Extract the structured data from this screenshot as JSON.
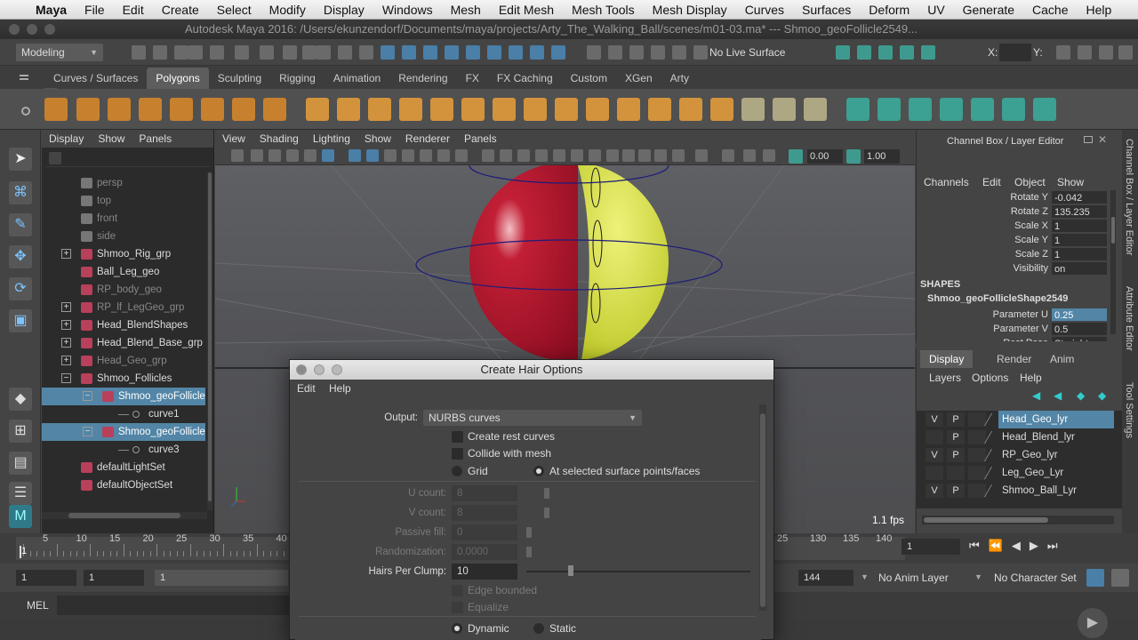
{
  "macmenu": {
    "apple": "",
    "items": [
      "Maya",
      "File",
      "Edit",
      "Create",
      "Select",
      "Modify",
      "Display",
      "Windows",
      "Mesh",
      "Edit Mesh",
      "Mesh Tools",
      "Mesh Display",
      "Curves",
      "Surfaces",
      "Deform",
      "UV",
      "Generate",
      "Cache",
      "Help"
    ]
  },
  "window": {
    "title": "Autodesk Maya 2016: /Users/ekunzendorf/Documents/maya/projects/Arty_The_Walking_Ball/scenes/m01-03.ma*   ---   Shmoo_geoFollicle2549..."
  },
  "statusline": {
    "menuset": "Modeling",
    "live_surface": "No Live Surface",
    "x_label": "X:",
    "y_label": "Y:"
  },
  "shelf_tabs": [
    "Curves / Surfaces",
    "Polygons",
    "Sculpting",
    "Rigging",
    "Animation",
    "Rendering",
    "FX",
    "FX Caching",
    "Custom",
    "XGen",
    "Arty"
  ],
  "outliner": {
    "menu": [
      "Display",
      "Show",
      "Panels"
    ],
    "rows": [
      {
        "label": "persp",
        "style": "dim",
        "indent": 0,
        "exp": ""
      },
      {
        "label": "top",
        "style": "dim",
        "indent": 0,
        "exp": ""
      },
      {
        "label": "front",
        "style": "dim",
        "indent": 0,
        "exp": ""
      },
      {
        "label": "side",
        "style": "dim",
        "indent": 0,
        "exp": ""
      },
      {
        "label": "Shmoo_Rig_grp",
        "style": "",
        "indent": 0,
        "exp": "+"
      },
      {
        "label": "Ball_Leg_geo",
        "style": "",
        "indent": 0,
        "exp": ""
      },
      {
        "label": "RP_body_geo",
        "style": "dim",
        "indent": 0,
        "exp": ""
      },
      {
        "label": "RP_lf_LegGeo_grp",
        "style": "dim",
        "indent": 0,
        "exp": "+"
      },
      {
        "label": "Head_BlendShapes",
        "style": "",
        "indent": 0,
        "exp": "+"
      },
      {
        "label": "Head_Blend_Base_grp",
        "style": "",
        "indent": 0,
        "exp": "+"
      },
      {
        "label": "Head_Geo_grp",
        "style": "dim",
        "indent": 0,
        "exp": "+"
      },
      {
        "label": "Shmoo_Follicles",
        "style": "",
        "indent": 0,
        "exp": "−"
      },
      {
        "label": "Shmoo_geoFollicle",
        "style": "sel",
        "indent": 1,
        "exp": "−"
      },
      {
        "label": "curve1",
        "style": "",
        "indent": 2,
        "exp": ""
      },
      {
        "label": "Shmoo_geoFollicle",
        "style": "sel",
        "indent": 1,
        "exp": "−"
      },
      {
        "label": "curve3",
        "style": "",
        "indent": 2,
        "exp": ""
      },
      {
        "label": "defaultLightSet",
        "style": "",
        "indent": 0,
        "exp": ""
      },
      {
        "label": "defaultObjectSet",
        "style": "",
        "indent": 0,
        "exp": ""
      }
    ]
  },
  "viewport": {
    "menu": [
      "View",
      "Shading",
      "Lighting",
      "Show",
      "Renderer",
      "Panels"
    ],
    "val1": "0.00",
    "val2": "1.00",
    "fps": "1.1 fps"
  },
  "channelbox": {
    "title": "Channel Box / Layer Editor",
    "menu": [
      "Channels",
      "Edit",
      "Object",
      "Show"
    ],
    "attrs": [
      {
        "label": "Rotate Y",
        "value": "-0.042",
        "hl": false
      },
      {
        "label": "Rotate Z",
        "value": "135.235",
        "hl": false
      },
      {
        "label": "Scale X",
        "value": "1",
        "hl": false
      },
      {
        "label": "Scale Y",
        "value": "1",
        "hl": false
      },
      {
        "label": "Scale Z",
        "value": "1",
        "hl": false
      },
      {
        "label": "Visibility",
        "value": "on",
        "hl": false
      }
    ],
    "shapes_header": "SHAPES",
    "shape_name": "Shmoo_geoFollicleShape2549",
    "shape_attrs": [
      {
        "label": "Parameter U",
        "value": "0.25",
        "hl": true
      },
      {
        "label": "Parameter V",
        "value": "0.5",
        "hl": false
      },
      {
        "label": "Rest Pose",
        "value": "Straight",
        "hl": false
      }
    ]
  },
  "layers": {
    "tabs": [
      "Display",
      "Render",
      "Anim"
    ],
    "menu": [
      "Layers",
      "Options",
      "Help"
    ],
    "rows": [
      {
        "v": "V",
        "p": "P",
        "name": "Head_Geo_lyr",
        "sel": true
      },
      {
        "v": "",
        "p": "P",
        "name": "Head_Blend_lyr",
        "sel": false
      },
      {
        "v": "V",
        "p": "P",
        "name": "RP_Geo_lyr",
        "sel": false
      },
      {
        "v": "",
        "p": "",
        "name": "Leg_Geo_Lyr",
        "sel": false
      },
      {
        "v": "V",
        "p": "P",
        "name": "Shmoo_Ball_Lyr",
        "sel": false
      }
    ]
  },
  "sidetabs": [
    "Channel Box / Layer Editor",
    "Attribute Editor",
    "Tool Settings"
  ],
  "timeline": {
    "ticks": [
      "5",
      "10",
      "15",
      "20",
      "25",
      "30",
      "35",
      "40"
    ],
    "ticks_right": [
      "25",
      "130",
      "135",
      "140"
    ],
    "start_marker": "1",
    "current_frame": "1"
  },
  "range": {
    "start": "1",
    "start2": "1",
    "start3": "1",
    "end": "144",
    "anim_layer": "No Anim Layer",
    "char_set": "No Character Set"
  },
  "mel": {
    "label": "MEL"
  },
  "dialog": {
    "title": "Create Hair Options",
    "menu": [
      "Edit",
      "Help"
    ],
    "output_label": "Output:",
    "output_value": "NURBS curves",
    "create_rest": "Create rest curves",
    "collide": "Collide with mesh",
    "grid": "Grid",
    "at_selected": "At selected surface points/faces",
    "u_count_label": "U count:",
    "u_count": "8",
    "v_count_label": "V count:",
    "v_count": "8",
    "passive_label": "Passive fill:",
    "passive": "0",
    "random_label": "Randomization:",
    "random": "0.0000",
    "hairs_label": "Hairs Per Clump:",
    "hairs": "10",
    "hairs_fraction": 0.2,
    "edge_bounded": "Edge bounded",
    "equalize": "Equalize",
    "dynamic": "Dynamic",
    "static": "Static"
  }
}
